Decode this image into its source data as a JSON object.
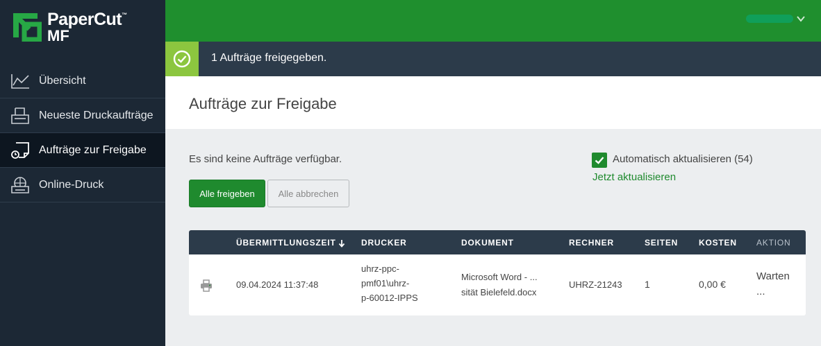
{
  "brand": {
    "name_line1": "PaperCut",
    "trademark": "™",
    "name_line2": "MF"
  },
  "colors": {
    "brand_green": "#1f8f2e",
    "sidebar_bg": "#1c2835",
    "notice_accent": "#8cc63f",
    "table_header": "#2c3b4a"
  },
  "sidebar": {
    "items": [
      {
        "label": "Übersicht",
        "icon": "chart-icon"
      },
      {
        "label": "Neueste Druckaufträge",
        "icon": "print-jobs-icon"
      },
      {
        "label": "Aufträge zur Freigabe",
        "icon": "release-jobs-icon",
        "active": true
      },
      {
        "label": "Online-Druck",
        "icon": "web-print-icon"
      }
    ]
  },
  "notice": {
    "text": "1 Aufträge freigegeben.",
    "icon": "check-circle-icon"
  },
  "page": {
    "title": "Aufträge zur Freigabe"
  },
  "content": {
    "empty_message": "Es sind keine Aufträge verfügbar.",
    "release_all_label": "Alle freigeben",
    "cancel_all_label": "Alle abbrechen",
    "auto_refresh_label": "Automatisch aktualisieren (54)",
    "auto_refresh_checked": true,
    "refresh_now_label": "Jetzt aktualisieren"
  },
  "table": {
    "columns": [
      "ÜBERMITTLUNGSZEIT",
      "DRUCKER",
      "DOKUMENT",
      "RECHNER",
      "SEITEN",
      "KOSTEN",
      "AKTION"
    ],
    "sort_column": "ÜBERMITTLUNGSZEIT",
    "sort_direction": "descending",
    "rows": [
      {
        "time": "09.04.2024 11:37:48",
        "printer": [
          "uhrz-ppc-",
          "pmf01\\uhrz-",
          "p-60012-IPPS"
        ],
        "document": [
          "Microsoft Word - ...",
          "sität Bielefeld.docx"
        ],
        "computer": "UHRZ-21243",
        "pages": "1",
        "cost": "0,00 €",
        "action": [
          "Warten",
          "..."
        ]
      }
    ]
  }
}
